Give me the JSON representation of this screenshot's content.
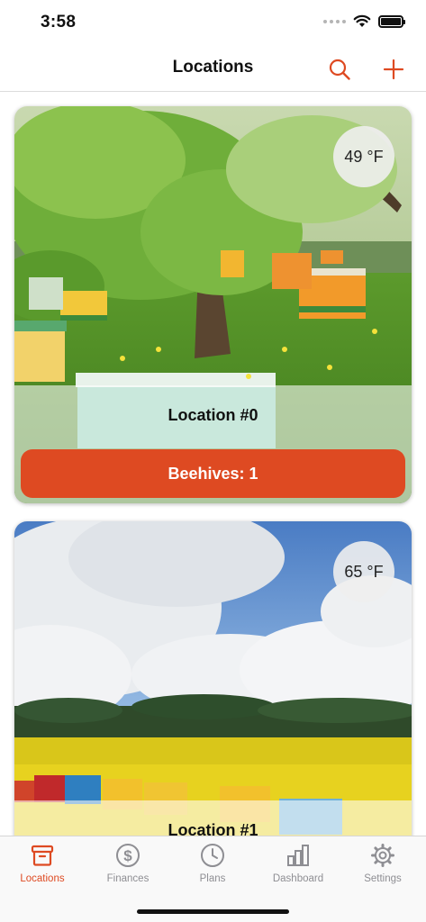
{
  "status_bar": {
    "time": "3:58"
  },
  "nav": {
    "title": "Locations",
    "search_icon": "search-icon",
    "add_icon": "plus-icon"
  },
  "colors": {
    "accent": "#de4a22",
    "inactive": "#8e8e93"
  },
  "locations": [
    {
      "name": "Location #0",
      "temperature": "49 °F",
      "beehives_label": "Beehives: 1",
      "scene": "apple orchard with colorful beehives"
    },
    {
      "name": "Location #1",
      "temperature": "65 °F",
      "scene": "cloudy sky over yellow rapeseed field with beehives"
    }
  ],
  "tabs": [
    {
      "label": "Locations",
      "icon": "archive-box-icon",
      "active": true
    },
    {
      "label": "Finances",
      "icon": "dollar-circle-icon",
      "active": false
    },
    {
      "label": "Plans",
      "icon": "clock-icon",
      "active": false
    },
    {
      "label": "Dashboard",
      "icon": "bar-chart-icon",
      "active": false
    },
    {
      "label": "Settings",
      "icon": "gear-icon",
      "active": false
    }
  ]
}
